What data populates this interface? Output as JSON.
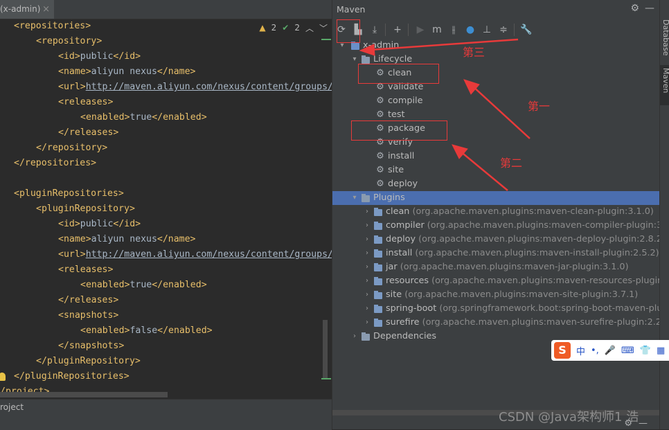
{
  "editor": {
    "tab_label": "(x-admin)",
    "tab_close": "×",
    "inspections": {
      "warnings": "2",
      "ok": "2"
    },
    "lines": [
      {
        "indent": 1,
        "parts": [
          {
            "k": "tag",
            "t": "<repositories>"
          }
        ]
      },
      {
        "indent": 2,
        "parts": [
          {
            "k": "tag",
            "t": "<repository>"
          }
        ]
      },
      {
        "indent": 3,
        "parts": [
          {
            "k": "tag",
            "t": "<id>"
          },
          {
            "k": "txt",
            "t": "public"
          },
          {
            "k": "tag",
            "t": "</id>"
          }
        ]
      },
      {
        "indent": 3,
        "parts": [
          {
            "k": "tag",
            "t": "<name>"
          },
          {
            "k": "txt",
            "t": "aliyun nexus"
          },
          {
            "k": "tag",
            "t": "</name>"
          }
        ]
      },
      {
        "indent": 3,
        "parts": [
          {
            "k": "tag",
            "t": "<url>"
          },
          {
            "k": "url",
            "t": "http://maven.aliyun.com/nexus/content/groups/"
          }
        ]
      },
      {
        "indent": 3,
        "parts": [
          {
            "k": "tag",
            "t": "<releases>"
          }
        ]
      },
      {
        "indent": 4,
        "parts": [
          {
            "k": "tag",
            "t": "<enabled>"
          },
          {
            "k": "txt",
            "t": "true"
          },
          {
            "k": "tag",
            "t": "</enabled>"
          }
        ]
      },
      {
        "indent": 3,
        "parts": [
          {
            "k": "tag",
            "t": "</releases>"
          }
        ]
      },
      {
        "indent": 2,
        "parts": [
          {
            "k": "tag",
            "t": "</repository>"
          }
        ]
      },
      {
        "indent": 1,
        "parts": [
          {
            "k": "tag",
            "t": "</repositories>"
          }
        ]
      },
      {
        "indent": 0,
        "parts": []
      },
      {
        "indent": 1,
        "parts": [
          {
            "k": "tag",
            "t": "<pluginRepositories>"
          }
        ]
      },
      {
        "indent": 2,
        "parts": [
          {
            "k": "tag",
            "t": "<pluginRepository>"
          }
        ]
      },
      {
        "indent": 3,
        "parts": [
          {
            "k": "tag",
            "t": "<id>"
          },
          {
            "k": "txt",
            "t": "public"
          },
          {
            "k": "tag",
            "t": "</id>"
          }
        ]
      },
      {
        "indent": 3,
        "parts": [
          {
            "k": "tag",
            "t": "<name>"
          },
          {
            "k": "txt",
            "t": "aliyun nexus"
          },
          {
            "k": "tag",
            "t": "</name>"
          }
        ]
      },
      {
        "indent": 3,
        "parts": [
          {
            "k": "tag",
            "t": "<url>"
          },
          {
            "k": "url",
            "t": "http://maven.aliyun.com/nexus/content/groups/"
          }
        ]
      },
      {
        "indent": 3,
        "parts": [
          {
            "k": "tag",
            "t": "<releases>"
          }
        ]
      },
      {
        "indent": 4,
        "parts": [
          {
            "k": "tag",
            "t": "<enabled>"
          },
          {
            "k": "txt",
            "t": "true"
          },
          {
            "k": "tag",
            "t": "</enabled>"
          }
        ]
      },
      {
        "indent": 3,
        "parts": [
          {
            "k": "tag",
            "t": "</releases>"
          }
        ]
      },
      {
        "indent": 3,
        "parts": [
          {
            "k": "tag",
            "t": "<snapshots>"
          }
        ]
      },
      {
        "indent": 4,
        "parts": [
          {
            "k": "tag",
            "t": "<enabled>"
          },
          {
            "k": "txt",
            "t": "false"
          },
          {
            "k": "tag",
            "t": "</enabled>"
          }
        ]
      },
      {
        "indent": 3,
        "parts": [
          {
            "k": "tag",
            "t": "</snapshots>"
          }
        ]
      },
      {
        "indent": 2,
        "parts": [
          {
            "k": "tag",
            "t": "</pluginRepository>"
          }
        ]
      },
      {
        "indent": 1,
        "parts": [
          {
            "k": "tag",
            "t": "</pluginRepositories>"
          }
        ]
      },
      {
        "indent": 0,
        "parts": [
          {
            "k": "tag",
            "t": "/project>"
          }
        ]
      }
    ],
    "status_text": "roject"
  },
  "maven": {
    "title": "Maven",
    "gear": "⚙",
    "minimize": "—",
    "toolbar": [
      {
        "name": "reload-icon",
        "glyph": "⟳",
        "dim": false
      },
      {
        "name": "generate-sources-icon",
        "glyph": "▙",
        "dim": false
      },
      {
        "name": "download-icon",
        "glyph": "⤓",
        "dim": false
      },
      {
        "name": "add-icon",
        "glyph": "+",
        "dim": false
      },
      {
        "name": "run-icon",
        "glyph": "▶",
        "dim": true
      },
      {
        "name": "execute-goal-icon",
        "glyph": "m",
        "dim": false
      },
      {
        "name": "toggle-offline-icon",
        "glyph": "⫲",
        "dim": false
      },
      {
        "name": "skip-tests-icon",
        "glyph": "●",
        "dim": false
      },
      {
        "name": "show-dependencies-icon",
        "glyph": "⊥",
        "dim": false
      },
      {
        "name": "collapse-all-icon",
        "glyph": "≑",
        "dim": false
      },
      {
        "name": "settings-wrench-icon",
        "glyph": "🔧",
        "dim": false
      }
    ],
    "tree": [
      {
        "level": 0,
        "arrow": "▾",
        "icon": "project",
        "label": "x-admin",
        "sub": ""
      },
      {
        "level": 1,
        "arrow": "▾",
        "icon": "folder",
        "label": "Lifecycle",
        "sub": ""
      },
      {
        "level": 2,
        "arrow": "",
        "icon": "gear",
        "label": "clean",
        "sub": ""
      },
      {
        "level": 2,
        "arrow": "",
        "icon": "gear",
        "label": "validate",
        "sub": ""
      },
      {
        "level": 2,
        "arrow": "",
        "icon": "gear",
        "label": "compile",
        "sub": ""
      },
      {
        "level": 2,
        "arrow": "",
        "icon": "gear",
        "label": "test",
        "sub": ""
      },
      {
        "level": 2,
        "arrow": "",
        "icon": "gear",
        "label": "package",
        "sub": ""
      },
      {
        "level": 2,
        "arrow": "",
        "icon": "gear",
        "label": "verify",
        "sub": ""
      },
      {
        "level": 2,
        "arrow": "",
        "icon": "gear",
        "label": "install",
        "sub": ""
      },
      {
        "level": 2,
        "arrow": "",
        "icon": "gear",
        "label": "site",
        "sub": ""
      },
      {
        "level": 2,
        "arrow": "",
        "icon": "gear",
        "label": "deploy",
        "sub": ""
      },
      {
        "level": 1,
        "arrow": "▾",
        "icon": "folder",
        "label": "Plugins",
        "sub": "",
        "selected": true
      },
      {
        "level": 2,
        "arrow": "›",
        "icon": "plugin",
        "label": "clean",
        "sub": "(org.apache.maven.plugins:maven-clean-plugin:3.1.0)"
      },
      {
        "level": 2,
        "arrow": "›",
        "icon": "plugin",
        "label": "compiler",
        "sub": "(org.apache.maven.plugins:maven-compiler-plugin:3.8.0)"
      },
      {
        "level": 2,
        "arrow": "›",
        "icon": "plugin",
        "label": "deploy",
        "sub": "(org.apache.maven.plugins:maven-deploy-plugin:2.8.2)"
      },
      {
        "level": 2,
        "arrow": "›",
        "icon": "plugin",
        "label": "install",
        "sub": "(org.apache.maven.plugins:maven-install-plugin:2.5.2)"
      },
      {
        "level": 2,
        "arrow": "›",
        "icon": "plugin",
        "label": "jar",
        "sub": "(org.apache.maven.plugins:maven-jar-plugin:3.1.0)"
      },
      {
        "level": 2,
        "arrow": "›",
        "icon": "plugin",
        "label": "resources",
        "sub": "(org.apache.maven.plugins:maven-resources-plugin:3.1.0)"
      },
      {
        "level": 2,
        "arrow": "›",
        "icon": "plugin",
        "label": "site",
        "sub": "(org.apache.maven.plugins:maven-site-plugin:3.7.1)"
      },
      {
        "level": 2,
        "arrow": "›",
        "icon": "plugin",
        "label": "spring-boot",
        "sub": "(org.springframework.boot:spring-boot-maven-plugin:2"
      },
      {
        "level": 2,
        "arrow": "›",
        "icon": "plugin",
        "label": "surefire",
        "sub": "(org.apache.maven.plugins:maven-surefire-plugin:2.22.1)"
      },
      {
        "level": 1,
        "arrow": "›",
        "icon": "deps",
        "label": "Dependencies",
        "sub": ""
      }
    ]
  },
  "sidebar": {
    "database": "Database",
    "maven": "Maven"
  },
  "annotations": {
    "first": "第一",
    "second": "第二",
    "third": "第三"
  },
  "ime": {
    "logo": "S",
    "items": [
      "中",
      "•,",
      "🎤",
      "⌨",
      "👕",
      "▦"
    ]
  },
  "watermark": "CSDN @Java架构师1 浩"
}
